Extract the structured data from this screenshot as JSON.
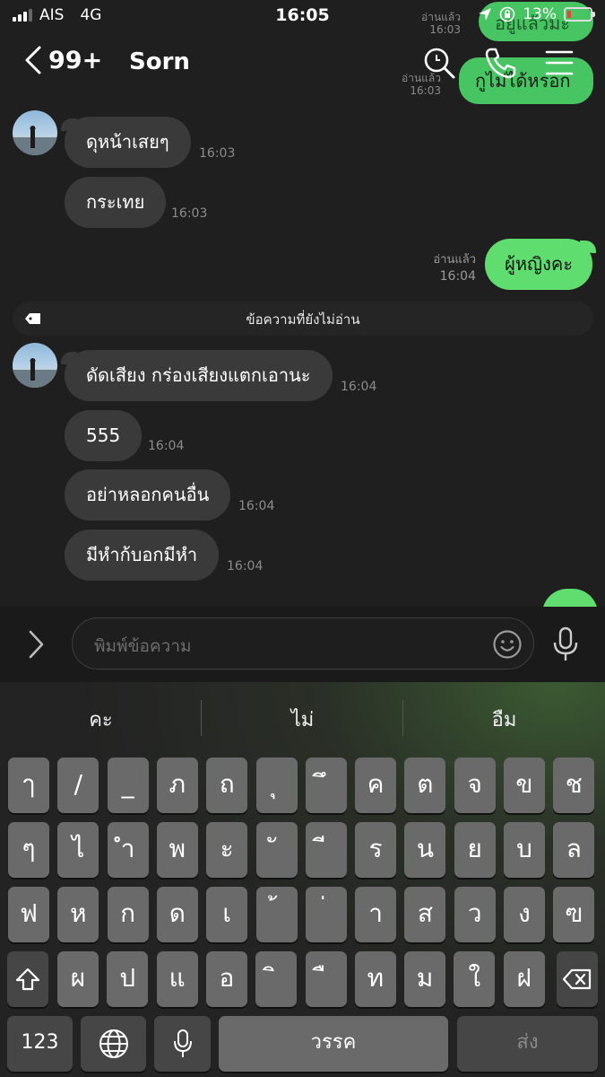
{
  "status_bar": {
    "carrier": "AIS",
    "network": "4G",
    "time": "16:05",
    "battery": "13%"
  },
  "header": {
    "back_count": "99+",
    "title": "Sorn"
  },
  "ghost": {
    "meta1_read": "อ่านแล้ว",
    "meta1_time": "16:03",
    "bubble1": "อยู่แล้วมะ",
    "meta2_read": "อ่านแล้ว",
    "meta2_time": "16:03",
    "bubble2": "กูไม่ได้หรอก"
  },
  "messages": [
    {
      "side": "in",
      "text": "ดุหน้าเสยๆ",
      "time": "16:03"
    },
    {
      "side": "in",
      "text": "กระเทย",
      "time": "16:03"
    },
    {
      "side": "out",
      "text": "ผู้หญิงคะ",
      "read": "อ่านแล้ว",
      "time": "16:04"
    },
    {
      "side": "in",
      "text": "ดัดเสียง กร่องเสียงแตกเอานะ",
      "time": "16:04"
    },
    {
      "side": "in",
      "text": "555",
      "time": "16:04"
    },
    {
      "side": "in",
      "text": "อย่าหลอกคนอื่น",
      "time": "16:04"
    },
    {
      "side": "in",
      "text": "มีหำก้บอกมีหำ",
      "time": "16:04"
    }
  ],
  "unread_divider": "ข้อความที่ยังไม่อ่าน",
  "input": {
    "placeholder": "พิมพ์ข้อความ"
  },
  "keyboard": {
    "suggestions": [
      "คะ",
      "ไม่",
      "อืม"
    ],
    "row1": [
      "ๅ",
      "/",
      "_",
      "ภ",
      "ถ",
      "ุ",
      "ึ",
      "ค",
      "ต",
      "จ",
      "ข",
      "ช"
    ],
    "row2": [
      "ๆ",
      "ไ",
      "ำ",
      "พ",
      "ะ",
      "ั",
      "ี",
      "ร",
      "น",
      "ย",
      "บ",
      "ล"
    ],
    "row3": [
      "ฟ",
      "ห",
      "ก",
      "ด",
      "เ",
      "้",
      "่",
      "า",
      "ส",
      "ว",
      "ง",
      "ฃ"
    ],
    "row4": [
      "ผ",
      "ป",
      "แ",
      "อ",
      "ิ",
      "ื",
      "ท",
      "ม",
      "ใ",
      "ฝ"
    ],
    "numbers_label": "123",
    "space_label": "วรรค",
    "send_label": "ส่ง"
  }
}
